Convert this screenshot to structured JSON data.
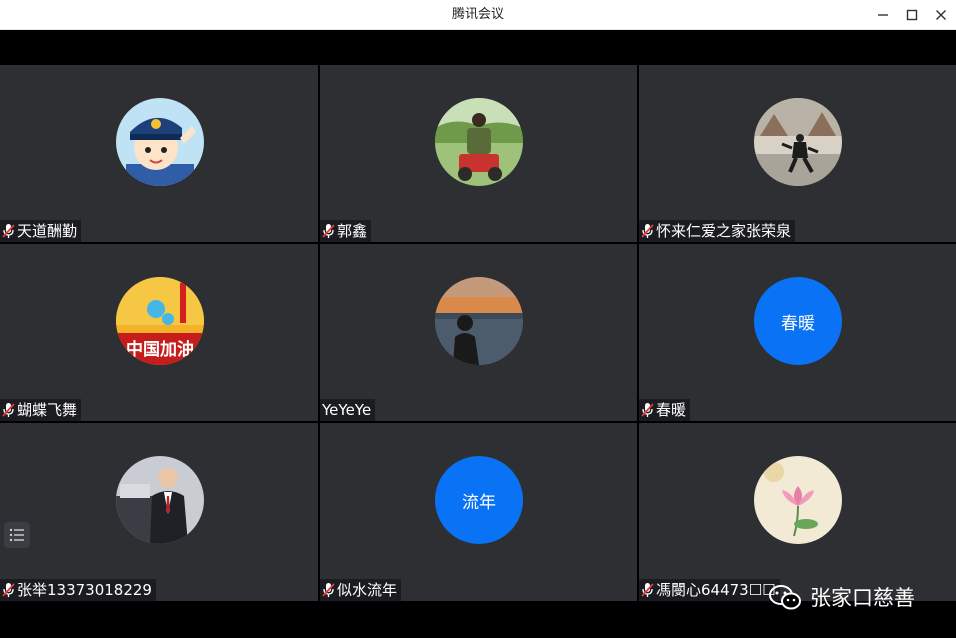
{
  "window": {
    "title": "腾讯会议"
  },
  "participants": [
    {
      "name": "天道酬勤",
      "mic": "muted",
      "avatar": "police-cartoon"
    },
    {
      "name": "郭鑫",
      "mic": "muted",
      "avatar": "photo-tractor"
    },
    {
      "name": "怀来仁爱之家张荣泉",
      "mic": "muted",
      "avatar": "photo-taichi"
    },
    {
      "name": "蝴蝶飞舞",
      "mic": "muted",
      "avatar": "china-flag-banner",
      "avatar_text": "中国加油"
    },
    {
      "name": "YeYeYe",
      "mic": "none",
      "avatar": "photo-sunset"
    },
    {
      "name": "春暖",
      "mic": "muted",
      "avatar": "text",
      "avatar_text": "春暖"
    },
    {
      "name": "张举13373018229",
      "mic": "muted",
      "avatar": "photo-man-suit"
    },
    {
      "name": "似水流年",
      "mic": "muted",
      "avatar": "text",
      "avatar_text": "流年"
    },
    {
      "name": "馮閿心64473☐☐",
      "mic": "muted",
      "avatar": "lotus-painting"
    }
  ],
  "watermark": {
    "text": "张家口慈善",
    "icon": "wechat-icon"
  },
  "colors": {
    "tile_bg": "#2e2f33",
    "avatar_blue": "#0a72f5",
    "mic_muted": "#e03a3a"
  }
}
